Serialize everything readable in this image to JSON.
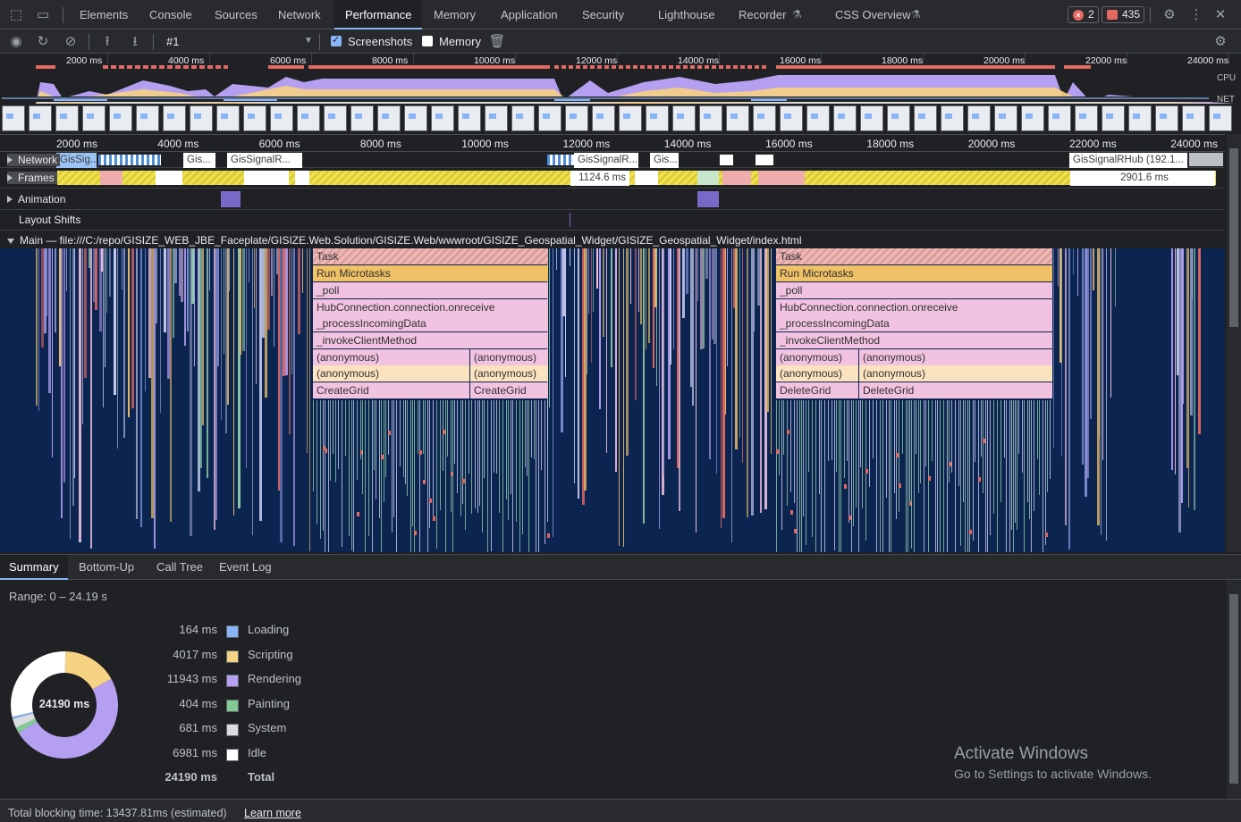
{
  "tabs": [
    {
      "label": "Elements",
      "active": false
    },
    {
      "label": "Console",
      "active": false
    },
    {
      "label": "Sources",
      "active": false
    },
    {
      "label": "Network",
      "active": false
    },
    {
      "label": "Performance",
      "active": true
    },
    {
      "label": "Memory",
      "active": false
    },
    {
      "label": "Application",
      "active": false
    },
    {
      "label": "Security",
      "active": false
    },
    {
      "label": "Lighthouse",
      "active": false
    },
    {
      "label": "Recorder",
      "active": false
    },
    {
      "label": "CSS Overview",
      "active": false
    }
  ],
  "badges": {
    "errors": "2",
    "messages": "435"
  },
  "toolbar": {
    "recording": "#1",
    "screenshots_label": "Screenshots",
    "screenshots_checked": true,
    "memory_label": "Memory",
    "memory_checked": false
  },
  "overview": {
    "ticks": [
      "2000 ms",
      "4000 ms",
      "6000 ms",
      "8000 ms",
      "10000 ms",
      "12000 ms",
      "14000 ms",
      "16000 ms",
      "18000 ms",
      "20000 ms",
      "22000 ms",
      "24000 ms"
    ],
    "cpu_label": "CPU",
    "net_label": "NET"
  },
  "ruler": {
    "ticks": [
      "2000 ms",
      "4000 ms",
      "6000 ms",
      "8000 ms",
      "10000 ms",
      "12000 ms",
      "14000 ms",
      "16000 ms",
      "18000 ms",
      "20000 ms",
      "22000 ms",
      "24000 ms"
    ]
  },
  "tracks": {
    "network": "Network",
    "network_items": [
      "GisSig...",
      "Gis...",
      "GisSignalR...",
      "GisSignalR...",
      "Gis...",
      "GisSignalRHub (192.1..."
    ],
    "frames": "Frames",
    "frame_times": [
      "1124.6 ms",
      "2901.6 ms"
    ],
    "animation": "Animation",
    "layout_shifts": "Layout Shifts",
    "main": "Main — file:///C:/repo/GISIZE_WEB_JBE_Faceplate/GISIZE.Web.Solution/GISIZE.Web/wwwroot/GISIZE_Geospatial_Widget/GISIZE_Geospatial_Widget/index.html"
  },
  "flame": {
    "left": {
      "task": "Task",
      "micro": "Run Microtasks",
      "poll": "_poll",
      "hub": "HubConnection.connection.onreceive",
      "process": "_processIncomingData",
      "invoke": "_invokeClientMethod",
      "anon1a": "(anonymous)",
      "anon1b": "(anonymous)",
      "anon2a": "(anonymous)",
      "anon2b": "(anonymous)",
      "grid_a": "CreateGrid",
      "grid_b": "CreateGrid"
    },
    "right": {
      "task": "Task",
      "micro": "Run Microtasks",
      "poll": "_poll",
      "hub": "HubConnection.connection.onreceive",
      "process": "_processIncomingData",
      "invoke": "_invokeClientMethod",
      "anon1a": "(anonymous)",
      "anon1b": "(anonymous)",
      "anon2a": "(anonymous)",
      "anon2b": "(anonymous)",
      "grid_a": "DeleteGrid",
      "grid_b": "DeleteGrid"
    }
  },
  "bottom_tabs": [
    "Summary",
    "Bottom-Up",
    "Call Tree",
    "Event Log"
  ],
  "summary": {
    "range": "Range: 0 – 24.19 s",
    "total_center": "24190 ms",
    "rows": [
      {
        "value": "164 ms",
        "name": "Loading",
        "color": "#8ab4f8",
        "ms": 164
      },
      {
        "value": "4017 ms",
        "name": "Scripting",
        "color": "#f6d283",
        "ms": 4017
      },
      {
        "value": "11943 ms",
        "name": "Rendering",
        "color": "#b59ff0",
        "ms": 11943
      },
      {
        "value": "404 ms",
        "name": "Painting",
        "color": "#81c995",
        "ms": 404
      },
      {
        "value": "681 ms",
        "name": "System",
        "color": "#dadce0",
        "ms": 681
      },
      {
        "value": "6981 ms",
        "name": "Idle",
        "color": "#ffffff",
        "ms": 6981
      }
    ],
    "total_value": "24190 ms",
    "total_label": "Total"
  },
  "status": {
    "text": "Total blocking time: 13437.81ms (estimated)",
    "link": "Learn more"
  },
  "watermark": {
    "line1": "Activate Windows",
    "line2": "Go to Settings to activate Windows."
  }
}
